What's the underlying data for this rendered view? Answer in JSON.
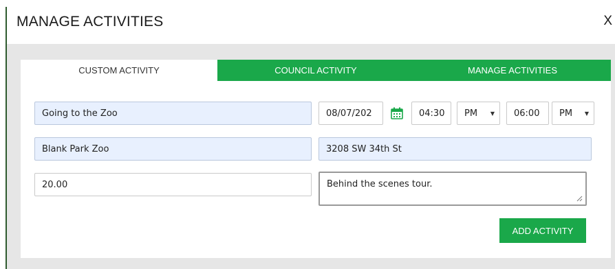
{
  "modal": {
    "title": "MANAGE ACTIVITIES",
    "close_label": "X"
  },
  "tabs": [
    {
      "label": "CUSTOM ACTIVITY",
      "active": true
    },
    {
      "label": "COUNCIL ACTIVITY",
      "active": false
    },
    {
      "label": "MANAGE ACTIVITIES",
      "active": false
    }
  ],
  "form": {
    "activity_name": "Going to the Zoo",
    "date": "08/07/202",
    "calendar_icon": "calendar-icon",
    "start_time": "04:30",
    "start_ampm": "PM",
    "end_time": "06:00",
    "end_ampm": "PM",
    "location": "Blank Park Zoo",
    "address": "3208 SW 34th St",
    "cost": "20.00",
    "notes": "Behind the scenes tour."
  },
  "actions": {
    "add_label": "ADD ACTIVITY"
  },
  "colors": {
    "accent_green": "#1aa84a",
    "autofill_blue": "#e8f0fe",
    "backdrop_gray": "#e6e6e6"
  }
}
